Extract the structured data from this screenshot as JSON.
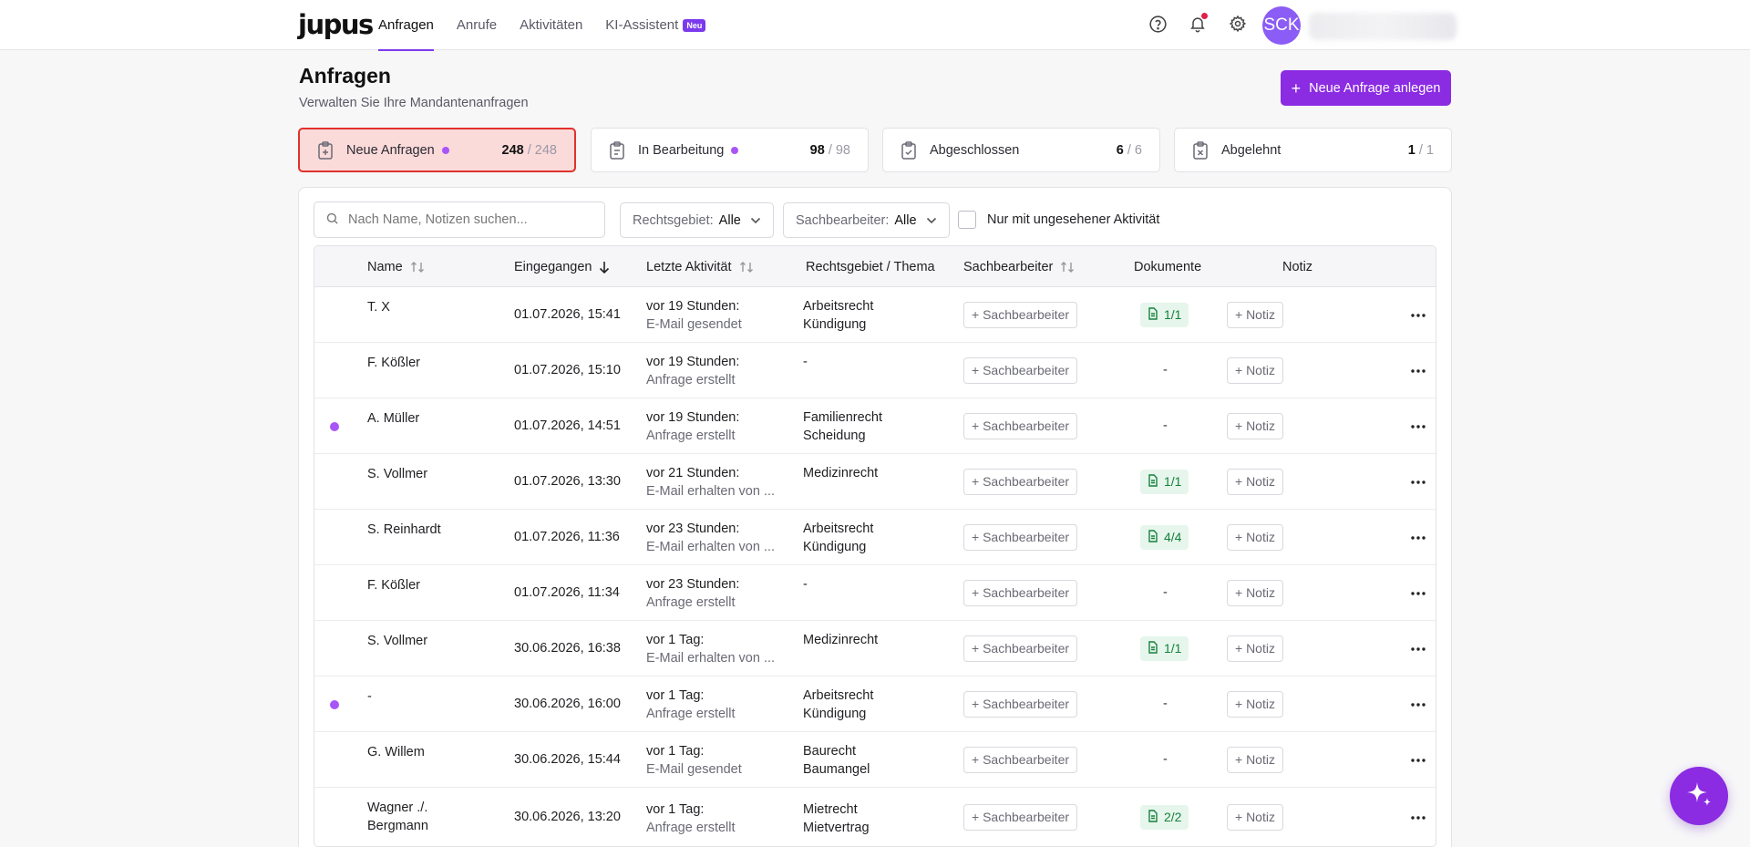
{
  "app": {
    "logo": "jupus"
  },
  "nav": [
    {
      "label": "Anfragen",
      "active": true
    },
    {
      "label": "Anrufe",
      "active": false
    },
    {
      "label": "Aktivitäten",
      "active": false
    },
    {
      "label": "KI-Assistent",
      "active": false,
      "badge": "Neu"
    }
  ],
  "user": {
    "initials": "SCK"
  },
  "header": {
    "title": "Anfragen",
    "subtitle": "Verwalten Sie Ihre Mandantenanfragen",
    "new_button": "Neue Anfrage anlegen"
  },
  "stats": [
    {
      "label": "Neue Anfragen",
      "count": "248",
      "total": "/ 248",
      "dot": true,
      "active": true
    },
    {
      "label": "In Bearbeitung",
      "count": "98",
      "total": "/ 98",
      "dot": true,
      "active": false
    },
    {
      "label": "Abgeschlossen",
      "count": "6",
      "total": "/ 6",
      "dot": false,
      "active": false
    },
    {
      "label": "Abgelehnt",
      "count": "1",
      "total": "/ 1",
      "dot": false,
      "active": false
    }
  ],
  "filters": {
    "search_placeholder": "Nach Name, Notizen suchen...",
    "rechtsgebiet_label": "Rechtsgebiet:",
    "rechtsgebiet_value": "Alle",
    "sachbearbeiter_label": "Sachbearbeiter:",
    "sachbearbeiter_value": "Alle",
    "unseen_label": "Nur mit ungesehener Aktivität"
  },
  "table": {
    "headers": {
      "name": "Name",
      "eingegangen": "Eingegangen",
      "aktivitaet": "Letzte Aktivität",
      "thema": "Rechtsgebiet / Thema",
      "sachbearbeiter": "Sachbearbeiter",
      "dokumente": "Dokumente",
      "notiz": "Notiz"
    },
    "assign_label": "+ Sachbearbeiter",
    "note_label": "+ Notiz",
    "rows": [
      {
        "name1": "T. X",
        "name2": "",
        "unread": false,
        "date": "01.07.2026, 15:41",
        "act1": "vor 19 Stunden:",
        "act2": "E-Mail gesendet",
        "area1": "Arbeitsrecht",
        "area2": "Kündigung",
        "docs": "1/1"
      },
      {
        "name1": "F. Kößler",
        "name2": "",
        "unread": false,
        "date": "01.07.2026, 15:10",
        "act1": "vor 19 Stunden:",
        "act2": "Anfrage erstellt",
        "area1": "-",
        "area2": "",
        "docs": "-"
      },
      {
        "name1": "A. Müller",
        "name2": "",
        "unread": true,
        "date": "01.07.2026, 14:51",
        "act1": "vor 19 Stunden:",
        "act2": "Anfrage erstellt",
        "area1": "Familienrecht",
        "area2": "Scheidung",
        "docs": "-"
      },
      {
        "name1": "S. Vollmer",
        "name2": "",
        "unread": false,
        "date": "01.07.2026, 13:30",
        "act1": "vor 21 Stunden:",
        "act2": "E-Mail erhalten von ...",
        "area1": "Medizinrecht",
        "area2": "",
        "docs": "1/1"
      },
      {
        "name1": "S. Reinhardt",
        "name2": "",
        "unread": false,
        "date": "01.07.2026, 11:36",
        "act1": "vor 23 Stunden:",
        "act2": "E-Mail erhalten von ...",
        "area1": "Arbeitsrecht",
        "area2": "Kündigung",
        "docs": "4/4"
      },
      {
        "name1": "F. Kößler",
        "name2": "",
        "unread": false,
        "date": "01.07.2026, 11:34",
        "act1": "vor 23 Stunden:",
        "act2": "Anfrage erstellt",
        "area1": "-",
        "area2": "",
        "docs": "-"
      },
      {
        "name1": "S. Vollmer",
        "name2": "",
        "unread": false,
        "date": "30.06.2026, 16:38",
        "act1": "vor 1 Tag:",
        "act2": "E-Mail erhalten von ...",
        "area1": "Medizinrecht",
        "area2": "",
        "docs": "1/1"
      },
      {
        "name1": "-",
        "name2": "",
        "unread": true,
        "date": "30.06.2026, 16:00",
        "act1": "vor 1 Tag:",
        "act2": "Anfrage erstellt",
        "area1": "Arbeitsrecht",
        "area2": "Kündigung",
        "docs": "-"
      },
      {
        "name1": "G. Willem",
        "name2": "",
        "unread": false,
        "date": "30.06.2026, 15:44",
        "act1": "vor 1 Tag:",
        "act2": "E-Mail gesendet",
        "area1": "Baurecht",
        "area2": "Baumangel",
        "docs": "-"
      },
      {
        "name1": "Wagner ./.",
        "name2": "Bergmann",
        "unread": false,
        "date": "30.06.2026, 13:20",
        "act1": "vor 1 Tag:",
        "act2": "Anfrage erstellt",
        "area1": "Mietrecht",
        "area2": "Mietvertrag",
        "docs": "2/2"
      }
    ]
  },
  "colors": {
    "accent": "#8b2be2",
    "unread_dot": "#a855f7",
    "active_card_bg": "#fbdada",
    "active_card_border": "#e0322b",
    "doc_badge_bg": "#e6f6ec",
    "doc_badge_text": "#16803c"
  }
}
